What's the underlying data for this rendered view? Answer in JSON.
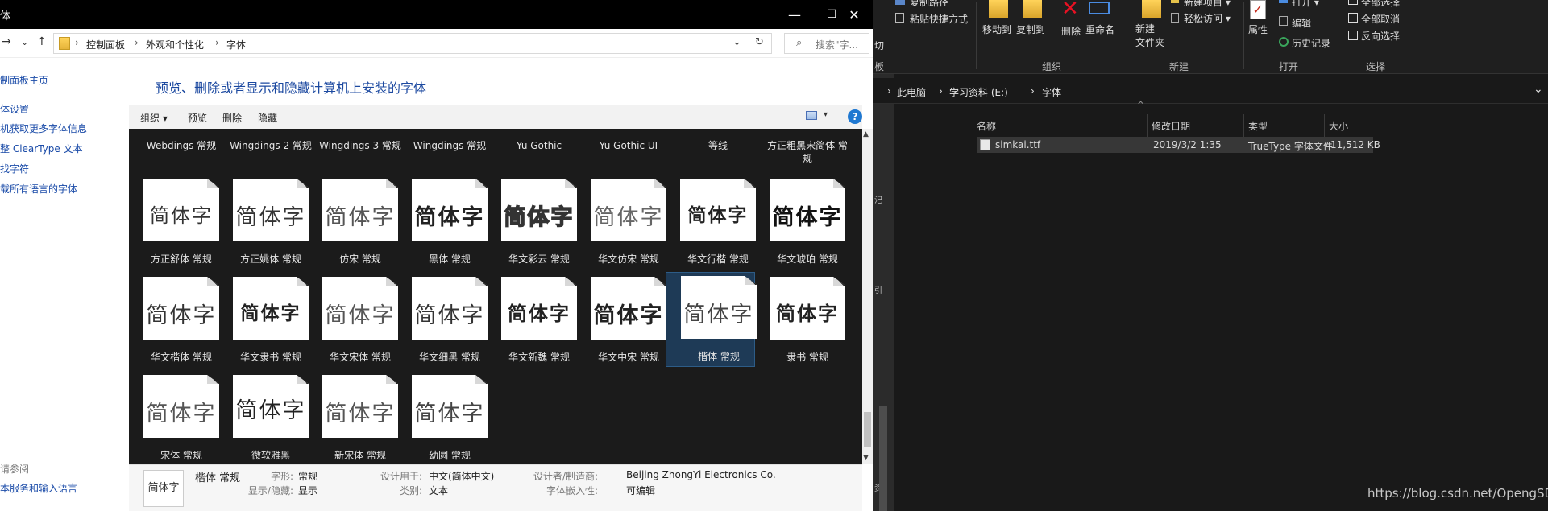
{
  "cp_window": {
    "title": "体",
    "win_controls": {
      "minimize": "—",
      "maximize": "☐",
      "close": "✕"
    },
    "nav": {
      "forward": "→",
      "recent": "⌄",
      "up": "↑",
      "path_dd": "⌄",
      "refresh": "↻"
    },
    "breadcrumb": [
      "控制面板",
      "外观和个性化",
      "字体"
    ],
    "crumb_sep": "›",
    "search_placeholder": "搜索\"字...",
    "search_icon": "⌕",
    "sidebar": {
      "links": [
        "制面板主页",
        "体设置",
        "机获取更多字体信息",
        "整 ClearType 文本",
        "找字符",
        "载所有语言的字体"
      ],
      "see_also": "请参阅",
      "see_also_link": "本服务和输入语言"
    },
    "heading": "预览、删除或者显示和隐藏计算机上安装的字体",
    "toolbar": {
      "organize": "组织 ▾",
      "preview": "预览",
      "delete": "删除",
      "hide": "隐藏",
      "view_dd": "▾",
      "help": "?"
    },
    "top_labels": [
      "Webdings 常规",
      "Wingdings 2 常规",
      "Wingdings 3 常规",
      "Wingdings 常规",
      "Yu Gothic",
      "Yu Gothic UI",
      "等线",
      "方正粗黑宋简体 常规"
    ],
    "font_items": [
      {
        "sample": "简体字",
        "label": "方正舒体 常规"
      },
      {
        "sample": "简体字",
        "label": "方正姚体 常规"
      },
      {
        "sample": "简体字",
        "label": "仿宋 常规"
      },
      {
        "sample": "简体字",
        "label": "黑体 常规"
      },
      {
        "sample": "简体字",
        "label": "华文彩云 常规"
      },
      {
        "sample": "简体字",
        "label": "华文仿宋 常规"
      },
      {
        "sample": "简体字",
        "label": "华文行楷 常规"
      },
      {
        "sample": "简体字",
        "label": "华文琥珀 常规"
      },
      {
        "sample": "简体字",
        "label": "华文楷体 常规"
      },
      {
        "sample": "简体字",
        "label": "华文隶书 常规"
      },
      {
        "sample": "简体字",
        "label": "华文宋体 常规"
      },
      {
        "sample": "简体字",
        "label": "华文细黑 常规"
      },
      {
        "sample": "简体字",
        "label": "华文新魏 常规"
      },
      {
        "sample": "简体字",
        "label": "华文中宋 常规"
      },
      {
        "sample": "简体字",
        "label": "楷体 常规",
        "selected": true
      },
      {
        "sample": "简体字",
        "label": "隶书 常规"
      },
      {
        "sample": "简体字",
        "label": "宋体 常规"
      },
      {
        "sample": "简体字",
        "label": "微软雅黑",
        "stacked": true
      },
      {
        "sample": "简体字",
        "label": "新宋体 常规"
      },
      {
        "sample": "简体字",
        "label": "幼圆 常规"
      }
    ],
    "details": {
      "thumb": "简体字",
      "name": "楷体 常规",
      "style_key": "字形:",
      "style_val": "常规",
      "show_key": "显示/隐藏:",
      "show_val": "显示",
      "designed_key": "设计用于:",
      "designed_val": "中文(简体中文)",
      "category_key": "类别:",
      "category_val": "文本",
      "designer_key": "设计者/制造商:",
      "designer_val": "Beijing ZhongYi Electronics Co.",
      "embed_key": "字体嵌入性:",
      "embed_val": "可编辑"
    }
  },
  "fe_window": {
    "leftstrip": [
      "切",
      "板"
    ],
    "ribbon": {
      "copy_path": "复制路径",
      "paste_shortcut": "粘贴快捷方式",
      "move_to": "移动到",
      "copy_to": "复制到",
      "delete": "删除",
      "rename": "重命名",
      "new_item": "新建项目 ▾",
      "easy_access": "轻松访问 ▾",
      "new_folder": "新建\n文件夹",
      "properties": "属性",
      "open": "打开 ▾",
      "edit": "编辑",
      "history": "历史记录",
      "select_all": "全部选择",
      "select_none": "全部取消",
      "invert": "反向选择",
      "groups": {
        "organize": "组织",
        "new": "新建",
        "open": "打开",
        "select": "选择",
        "clipboard": "板"
      }
    },
    "address": {
      "this_pc": "此电脑",
      "drive": "学习资料 (E:)",
      "folder": "字体",
      "sep": "›",
      "dd": "⌄"
    },
    "columns": {
      "name": "名称",
      "modified": "修改日期",
      "type": "类型",
      "size": "大小",
      "sort_arrow": "^"
    },
    "file": {
      "name": "simkai.ttf",
      "modified": "2019/3/2 1:35",
      "type": "TrueType 字体文件",
      "size": "11,512 KB"
    }
  },
  "watermark": "https://blog.csdn.net/OpengSD"
}
